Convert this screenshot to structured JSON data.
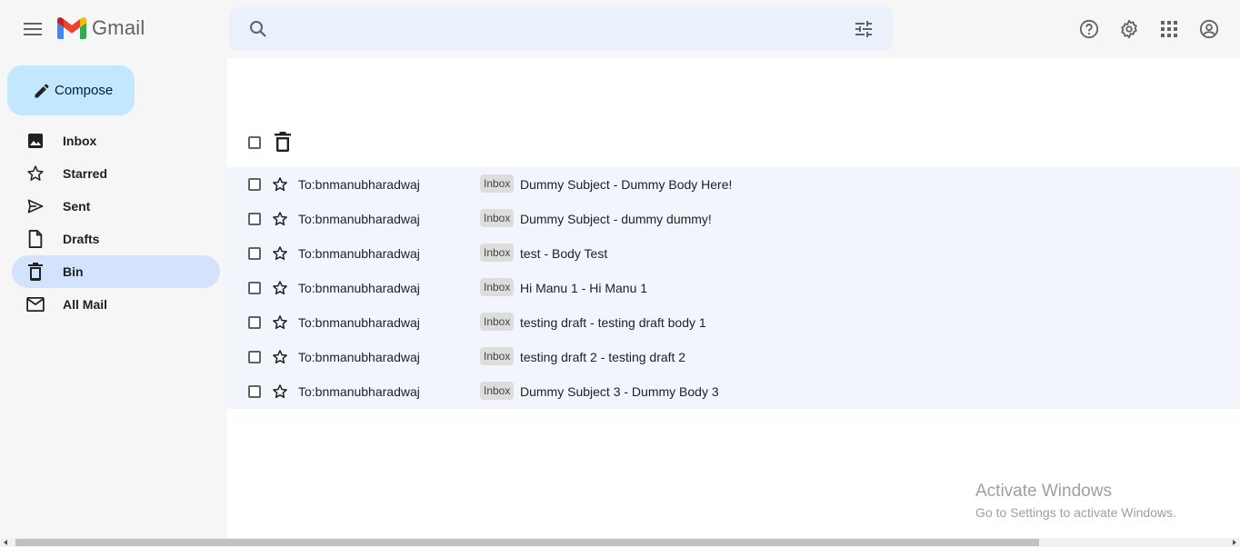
{
  "header": {
    "app_name": "Gmail",
    "search_placeholder": ""
  },
  "sidebar": {
    "compose_label": "Compose",
    "items": [
      {
        "label": "Inbox",
        "icon": "image-icon",
        "active": false
      },
      {
        "label": "Starred",
        "icon": "star-icon",
        "active": false
      },
      {
        "label": "Sent",
        "icon": "send-icon",
        "active": false
      },
      {
        "label": "Drafts",
        "icon": "draft-icon",
        "active": false
      },
      {
        "label": "Bin",
        "icon": "trash-icon",
        "active": true
      },
      {
        "label": "All Mail",
        "icon": "mail-icon",
        "active": false
      }
    ]
  },
  "emails": [
    {
      "to": "To:bnmanubharadwaj",
      "tag": "Inbox",
      "subject": "Dummy Subject - Dummy Body Here!"
    },
    {
      "to": "To:bnmanubharadwaj",
      "tag": "Inbox",
      "subject": "Dummy Subject - dummy dummy!"
    },
    {
      "to": "To:bnmanubharadwaj",
      "tag": "Inbox",
      "subject": "test - Body Test"
    },
    {
      "to": "To:bnmanubharadwaj",
      "tag": "Inbox",
      "subject": "Hi Manu 1 - Hi Manu 1"
    },
    {
      "to": "To:bnmanubharadwaj",
      "tag": "Inbox",
      "subject": "testing draft - testing draft body 1"
    },
    {
      "to": "To:bnmanubharadwaj",
      "tag": "Inbox",
      "subject": "testing draft 2 - testing draft 2"
    },
    {
      "to": "To:bnmanubharadwaj",
      "tag": "Inbox",
      "subject": "Dummy Subject 3 - Dummy Body 3"
    }
  ],
  "watermark": {
    "line1": "Activate Windows",
    "line2": "Go to Settings to activate Windows."
  },
  "colors": {
    "compose_bg": "#c2e7ff",
    "active_nav_bg": "#d3e3fd",
    "search_bg": "#eaf1fb",
    "list_bg": "#f2f6fc"
  }
}
